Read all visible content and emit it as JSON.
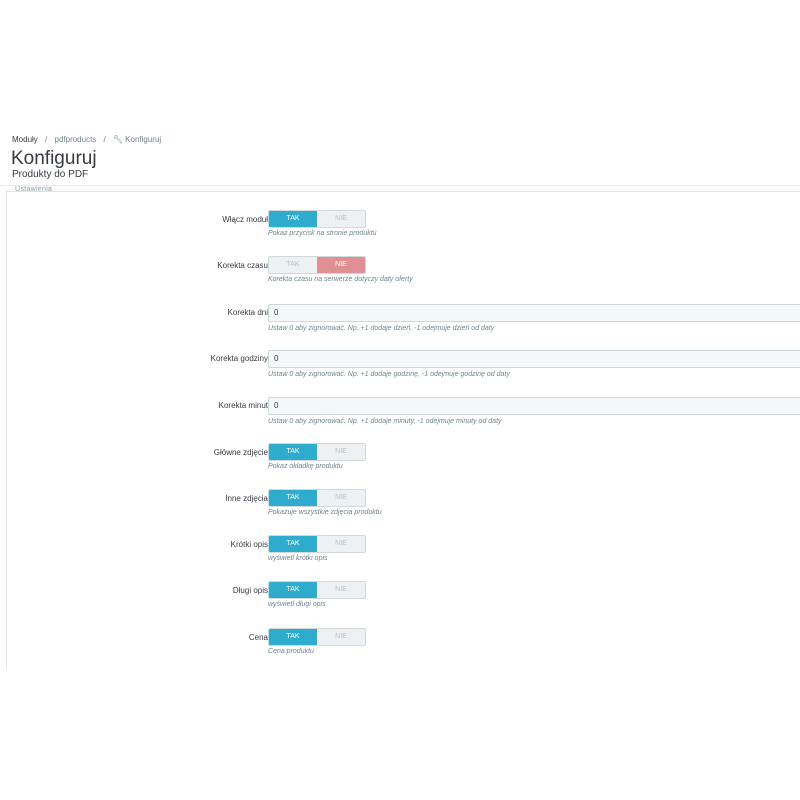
{
  "breadcrumb": {
    "items": [
      "Moduły",
      "pdfproducts",
      "Konfiguruj"
    ],
    "separator": "/"
  },
  "page": {
    "title": "Konfiguruj",
    "subtitle": "Produkty do PDF"
  },
  "panel": {
    "heading": "Ustawienia"
  },
  "colors": {
    "accent": "#2eacce",
    "danger": "#e08f95"
  },
  "fields": [
    {
      "label": "Włącz moduł",
      "type": "switch",
      "yes": "TAK",
      "no": "NIE",
      "value": "yes",
      "help": "Pokaż przycisk na stronie produktu"
    },
    {
      "label": "Korekta czasu",
      "type": "switch",
      "yes": "TAK",
      "no": "NIE",
      "value": "no",
      "help": "Korekta czasu na serwerze dotyczy daty oferty"
    },
    {
      "label": "Korekta dni",
      "type": "text",
      "value": "0",
      "help": "Ustaw 0 aby zignorować. Np. +1 dodaje dzień, -1 odejmuje dzień od daty"
    },
    {
      "label": "Korekta godziny",
      "type": "text",
      "value": "0",
      "help": "Ustaw 0 aby zignorować. Np. +1 dodaje godzinę, -1 odejmuje godzinę od daty"
    },
    {
      "label": "Korekta minut",
      "type": "text",
      "value": "0",
      "help": "Ustaw 0 aby zignorować. Np. +1 dodaje minuty, -1 odejmuje minuty od daty"
    },
    {
      "label": "Główne zdjęcie",
      "type": "switch",
      "yes": "TAK",
      "no": "NIE",
      "value": "yes",
      "help": "Pokaż okładkę produktu"
    },
    {
      "label": "Inne zdjęcia",
      "type": "switch",
      "yes": "TAK",
      "no": "NIE",
      "value": "yes",
      "help": "Pokazuje wszystkie zdjęcia produktu"
    },
    {
      "label": "Krótki opis",
      "type": "switch",
      "yes": "TAK",
      "no": "NIE",
      "value": "yes",
      "help": "wyświetl krótki opis"
    },
    {
      "label": "Długi opis",
      "type": "switch",
      "yes": "TAK",
      "no": "NIE",
      "value": "yes",
      "help": "wyświetl długi opis"
    },
    {
      "label": "Cena",
      "type": "switch",
      "yes": "TAK",
      "no": "NIE",
      "value": "yes",
      "help": "Cena produktu"
    }
  ]
}
